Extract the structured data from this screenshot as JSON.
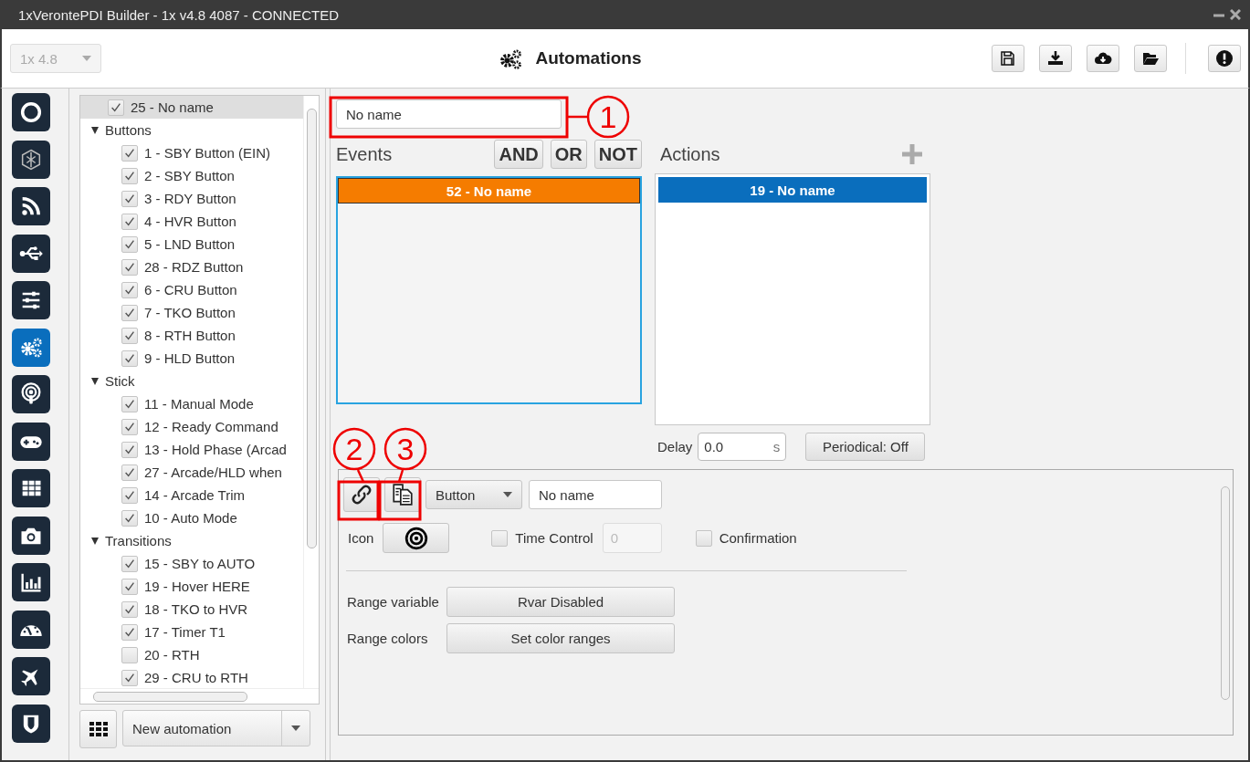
{
  "window": {
    "title": "1xVerontePDI Builder - 1x v4.8 4087 - CONNECTED"
  },
  "header": {
    "version": {
      "value": "1x 4.8",
      "disabled": true
    },
    "title": "Automations",
    "tools": [
      {
        "kind": "save"
      },
      {
        "kind": "download"
      },
      {
        "kind": "cloud"
      },
      {
        "kind": "folder"
      },
      {
        "kind": "alert"
      }
    ]
  },
  "nav": [
    {
      "kind": "ring",
      "selected": false
    },
    {
      "kind": "hexagon",
      "selected": false
    },
    {
      "kind": "rss",
      "selected": false
    },
    {
      "kind": "usb",
      "selected": false
    },
    {
      "kind": "sliders",
      "selected": false
    },
    {
      "kind": "gears",
      "selected": true
    },
    {
      "kind": "podcast",
      "selected": false
    },
    {
      "kind": "gamepad",
      "selected": false
    },
    {
      "kind": "grid",
      "selected": false
    },
    {
      "kind": "camera",
      "selected": false
    },
    {
      "kind": "chart",
      "selected": false
    },
    {
      "kind": "gauge",
      "selected": false
    },
    {
      "kind": "plane",
      "selected": false
    },
    {
      "kind": "shield",
      "selected": false
    }
  ],
  "tree": {
    "root": {
      "label": "25 - No name",
      "checked": true,
      "selected": true
    },
    "groups": [
      {
        "label": "Buttons",
        "expanded": true,
        "children": [
          {
            "label": "1 - SBY Button (EIN)",
            "checked": true
          },
          {
            "label": "2 - SBY Button",
            "checked": true
          },
          {
            "label": "3 - RDY Button",
            "checked": true
          },
          {
            "label": "4 - HVR Button",
            "checked": true
          },
          {
            "label": "5 - LND Button",
            "checked": true
          },
          {
            "label": "28 - RDZ Button",
            "checked": true
          },
          {
            "label": "6 - CRU Button",
            "checked": true
          },
          {
            "label": "7 - TKO Button",
            "checked": true
          },
          {
            "label": "8 - RTH Button",
            "checked": true
          },
          {
            "label": "9 - HLD Button",
            "checked": true
          }
        ]
      },
      {
        "label": "Stick",
        "expanded": true,
        "children": [
          {
            "label": "11 - Manual Mode",
            "checked": true
          },
          {
            "label": "12 - Ready Command",
            "checked": true
          },
          {
            "label": "13 - Hold Phase (Arcad",
            "checked": true
          },
          {
            "label": "27 - Arcade/HLD when",
            "checked": true
          },
          {
            "label": "14 - Arcade Trim",
            "checked": true
          },
          {
            "label": "10 - Auto Mode",
            "checked": true
          }
        ]
      },
      {
        "label": "Transitions",
        "expanded": true,
        "children": [
          {
            "label": "15 - SBY to AUTO",
            "checked": true
          },
          {
            "label": "19 - Hover HERE",
            "checked": true
          },
          {
            "label": "18 - TKO to HVR",
            "checked": true
          },
          {
            "label": "17 - Timer T1",
            "checked": true
          },
          {
            "label": "20 - RTH",
            "checked": false
          },
          {
            "label": "29 - CRU to RTH",
            "checked": true
          }
        ]
      }
    ]
  },
  "new_automation": {
    "value": "New automation"
  },
  "automation": {
    "name": "No name",
    "events": {
      "label": "Events",
      "operators": [
        "AND",
        "OR",
        "NOT"
      ],
      "items": [
        {
          "label": "52 - No name",
          "color": "#f57c00"
        }
      ]
    },
    "actions": {
      "label": "Actions",
      "items": [
        {
          "label": "19 - No name",
          "color": "#0a6ebd"
        }
      ]
    },
    "delay": {
      "label": "Delay",
      "value": "0.0",
      "unit": "s"
    },
    "periodical": "Periodical: Off"
  },
  "widget": {
    "type": "Button",
    "name": "No name",
    "icon_label": "Icon",
    "time_control": {
      "label": "Time Control",
      "checked": false,
      "value": "0"
    },
    "confirmation": {
      "label": "Confirmation",
      "checked": false
    },
    "range_variable": {
      "label": "Range variable",
      "button": "Rvar Disabled"
    },
    "range_colors": {
      "label": "Range colors",
      "button": "Set color ranges"
    }
  },
  "annotations": [
    {
      "label": "1"
    },
    {
      "label": "2"
    },
    {
      "label": "3"
    }
  ]
}
